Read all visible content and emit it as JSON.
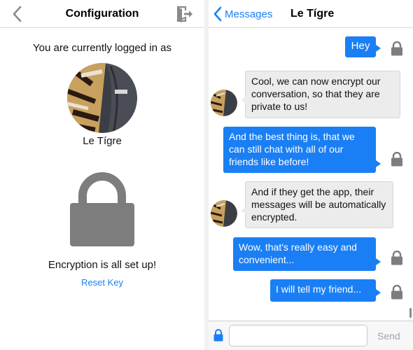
{
  "config": {
    "title": "Configuration",
    "logged_in_label": "You are currently logged in as",
    "user_name": "Le Tígre",
    "encryption_status": "Encryption is all set up!",
    "reset_key_label": "Reset Key"
  },
  "chat": {
    "back_label": "Messages",
    "contact_name": "Le Tígre",
    "messages": [
      {
        "direction": "outgoing",
        "text": "Hey"
      },
      {
        "direction": "incoming",
        "text": "Cool, we can now encrypt our conversation, so that they are private to us!"
      },
      {
        "direction": "outgoing",
        "text": "And the best thing is, that we can still chat with all of our friends like before!"
      },
      {
        "direction": "incoming",
        "text": "And if they get the app, their messages will be automatically encrypted."
      },
      {
        "direction": "outgoing",
        "text": "Wow, that's really easy and convenient..."
      },
      {
        "direction": "outgoing",
        "text": "I will tell my friend..."
      }
    ],
    "input_placeholder": "",
    "send_label": "Send"
  },
  "colors": {
    "accent_blue": "#1a7ff5",
    "lock_gray": "#7d7d7d",
    "incoming_bubble": "#ececec"
  },
  "icons": {
    "back": "chevron-left-icon",
    "logout": "logout-icon",
    "lock": "lock-icon",
    "avatar": "tiger-avatar"
  }
}
